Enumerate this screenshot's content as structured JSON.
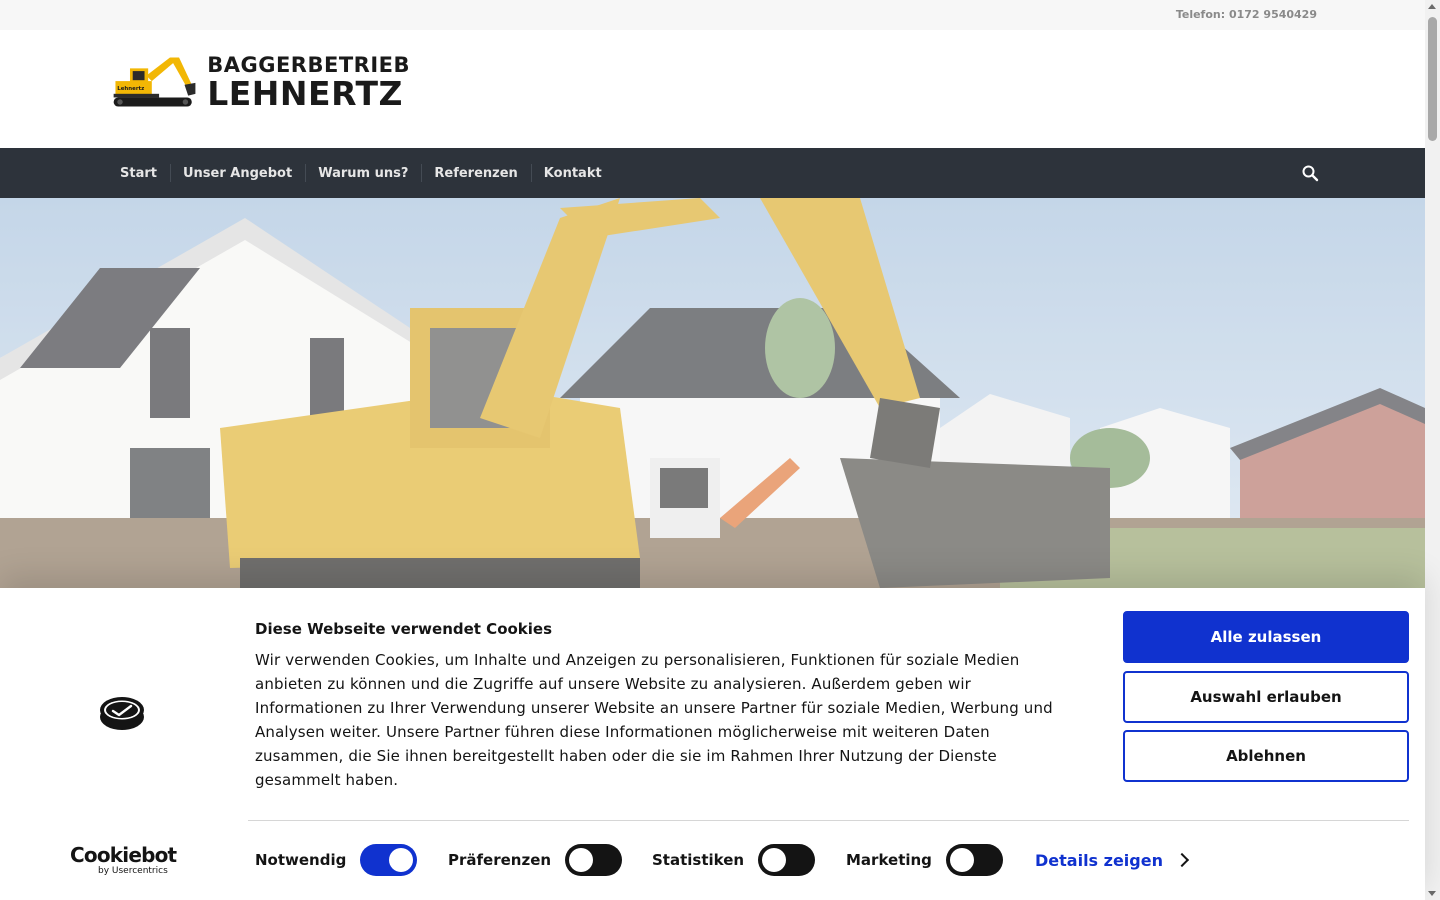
{
  "topbar": {
    "phone": "Telefon: 0172 9540429"
  },
  "logo": {
    "line1": "BAGGERBETRIEB",
    "line2": "LEHNERTZ",
    "machine_label": "Lehnertz"
  },
  "nav": {
    "items": [
      {
        "label": "Start"
      },
      {
        "label": "Unser Angebot"
      },
      {
        "label": "Warum uns?"
      },
      {
        "label": "Referenzen"
      },
      {
        "label": "Kontakt"
      }
    ],
    "search_icon": "search-icon"
  },
  "hero": {
    "image": "excavator-construction-site"
  },
  "cookie": {
    "title": "Diese Webseite verwendet Cookies",
    "text": "Wir verwenden Cookies, um Inhalte und Anzeigen zu personalisieren, Funktionen für soziale Medien anbieten zu können und die Zugriffe auf unsere Website zu analysieren. Außerdem geben wir Informationen zu Ihrer Verwendung unserer Website an unsere Partner für soziale Medien, Werbung und Analysen weiter. Unsere Partner führen diese Informationen möglicherweise mit weiteren Daten zusammen, die Sie ihnen bereitgestellt haben oder die sie im Rahmen Ihrer Nutzung der Dienste gesammelt haben.",
    "buttons": {
      "allow_all": "Alle zulassen",
      "allow_selection": "Auswahl erlauben",
      "deny": "Ablehnen"
    },
    "toggles": [
      {
        "label": "Notwendig",
        "on": true
      },
      {
        "label": "Präferenzen",
        "on": false
      },
      {
        "label": "Statistiken",
        "on": false
      },
      {
        "label": "Marketing",
        "on": false
      }
    ],
    "details_label": "Details zeigen",
    "brand": {
      "name": "Cookiebot",
      "by": "by Usercentrics"
    },
    "colors": {
      "accent": "#1032cf",
      "nav_bg": "#2d333b"
    }
  }
}
